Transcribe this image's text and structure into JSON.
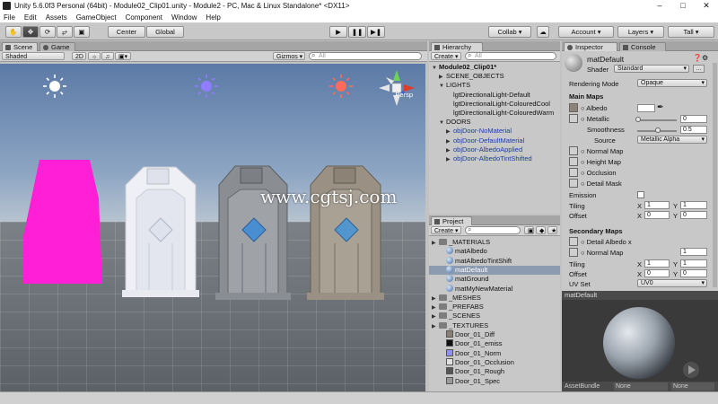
{
  "window": {
    "title": "Unity 5.6.0f3 Personal (64bit) - Module02_Clip01.unity - Module2 - PC, Mac & Linux Standalone* <DX11>"
  },
  "menu": [
    "File",
    "Edit",
    "Assets",
    "GameObject",
    "Component",
    "Window",
    "Help"
  ],
  "toolbar": {
    "pivot": "Center",
    "space": "Global",
    "collab": "Collab",
    "account": "Account",
    "layers": "Layers",
    "layout": "Tall"
  },
  "scene": {
    "tab": "Scene",
    "game_tab": "Game",
    "shading": "Shaded",
    "mode2d": "2D",
    "gizmos": "Gizmos",
    "search_placeholder": "All",
    "persp": "Persp",
    "watermark": "www.cgtsj.com"
  },
  "hierarchy": {
    "tab": "Hierarchy",
    "create": "Create",
    "search_placeholder": "All",
    "rows": [
      {
        "label": "Module02_Clip01*",
        "indent": 0,
        "tri": "▼",
        "style": "bold"
      },
      {
        "label": "SCENE_OBJECTS",
        "indent": 1,
        "tri": "▶",
        "style": ""
      },
      {
        "label": "LIGHTS",
        "indent": 1,
        "tri": "▼",
        "style": ""
      },
      {
        "label": "lgtDirectionalLight-Default",
        "indent": 2,
        "tri": "",
        "style": ""
      },
      {
        "label": "lgtDirectionalLight-ColouredCool",
        "indent": 2,
        "tri": "",
        "style": ""
      },
      {
        "label": "lgtDirectionalLight-ColouredWarm",
        "indent": 2,
        "tri": "",
        "style": ""
      },
      {
        "label": "DOORS",
        "indent": 1,
        "tri": "▼",
        "style": ""
      },
      {
        "label": "objDoor-NoMaterial",
        "indent": 2,
        "tri": "▶",
        "style": "blue"
      },
      {
        "label": "objDoor-DefaultMaterial",
        "indent": 2,
        "tri": "▶",
        "style": "blue"
      },
      {
        "label": "objDoor-AlbedoApplied",
        "indent": 2,
        "tri": "▶",
        "style": "blue"
      },
      {
        "label": "objDoor-AlbedoTintShifted",
        "indent": 2,
        "tri": "▶",
        "style": "blue"
      }
    ]
  },
  "project": {
    "tab": "Project",
    "create": "Create",
    "rows": [
      {
        "label": "_MATERIALS",
        "kind": "folder",
        "indent": 0,
        "sel": false
      },
      {
        "label": "matAlbedo",
        "kind": "mat",
        "indent": 1,
        "sel": false
      },
      {
        "label": "matAlbedoTintShift",
        "kind": "mat",
        "indent": 1,
        "sel": false
      },
      {
        "label": "matDefault",
        "kind": "mat",
        "indent": 1,
        "sel": true
      },
      {
        "label": "matGround",
        "kind": "mat",
        "indent": 1,
        "sel": false
      },
      {
        "label": "matMyNewMaterial",
        "kind": "mat",
        "indent": 1,
        "sel": false
      },
      {
        "label": "_MESHES",
        "kind": "folder",
        "indent": 0,
        "sel": false
      },
      {
        "label": "_PREFABS",
        "kind": "folder",
        "indent": 0,
        "sel": false
      },
      {
        "label": "_SCENES",
        "kind": "folder",
        "indent": 0,
        "sel": false
      },
      {
        "label": "_TEXTURES",
        "kind": "folder",
        "indent": 0,
        "sel": false
      },
      {
        "label": "Door_01_Diff",
        "kind": "tex",
        "color": "#8a7f74",
        "indent": 1,
        "sel": false
      },
      {
        "label": "Door_01_emiss",
        "kind": "tex",
        "color": "#111111",
        "indent": 1,
        "sel": false
      },
      {
        "label": "Door_01_Norm",
        "kind": "tex",
        "color": "#8f8fff",
        "indent": 1,
        "sel": false
      },
      {
        "label": "Door_01_Occlusion",
        "kind": "tex",
        "color": "#e0e0e0",
        "indent": 1,
        "sel": false
      },
      {
        "label": "Door_01_Rough",
        "kind": "tex",
        "color": "#555555",
        "indent": 1,
        "sel": false
      },
      {
        "label": "Door_01_Spec",
        "kind": "tex",
        "color": "#9a9a9a",
        "indent": 1,
        "sel": false
      }
    ]
  },
  "inspector": {
    "tab": "Inspector",
    "console_tab": "Console",
    "material_name": "matDefault",
    "shader_label": "Shader",
    "shader_value": "Standard",
    "rendering_mode_label": "Rendering Mode",
    "rendering_mode_value": "Opaque",
    "main_maps": "Main Maps",
    "albedo": "Albedo",
    "metallic": "Metallic",
    "metallic_value": "0",
    "smoothness": "Smoothness",
    "smoothness_value": "0.5",
    "source": "Source",
    "source_value": "Metallic Alpha",
    "normal_map": "Normal Map",
    "height_map": "Height Map",
    "occlusion": "Occlusion",
    "detail_mask": "Detail Mask",
    "emission": "Emission",
    "tiling": "Tiling",
    "offset": "Offset",
    "x": "X",
    "y": "Y",
    "tiling_x": "1",
    "tiling_y": "1",
    "offset_x": "0",
    "offset_y": "0",
    "secondary_maps": "Secondary Maps",
    "detail_albedo": "Detail Albedo x",
    "sec_normal_map": "Normal Map",
    "sec_normal_value": "1",
    "sec_tiling_x": "1",
    "sec_tiling_y": "1",
    "sec_offset_x": "0",
    "sec_offset_y": "0",
    "uv_set": "UV Set",
    "uv_set_value": "UV0",
    "preview_title": "matDefault",
    "assetbundle_label": "AssetBundle",
    "assetbundle_value": "None",
    "assetbundle_value2": "None"
  },
  "colors": {
    "pink": "#ff1fd6",
    "accent": "#3a78d8"
  }
}
